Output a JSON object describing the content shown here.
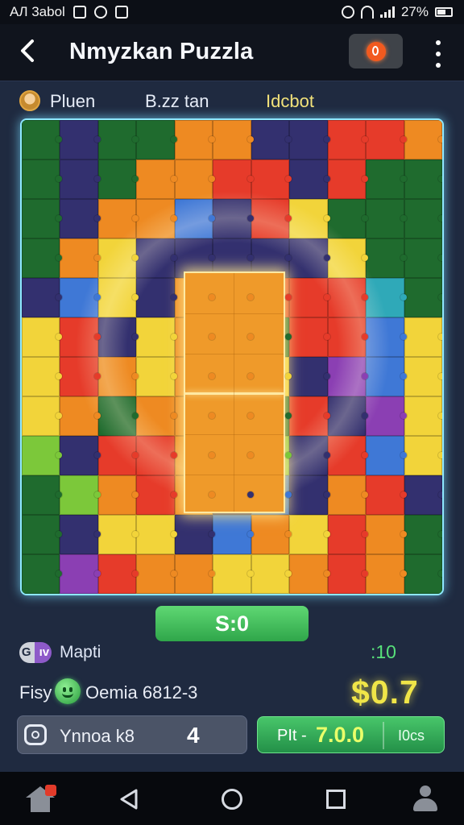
{
  "status_bar": {
    "left_text": "AЛ 3abol",
    "battery": "27%"
  },
  "header": {
    "title": "Nmyzkan Puzzla"
  },
  "info": {
    "player": "Pluen",
    "middle": "B.zz tan",
    "mode": "Idcbot"
  },
  "board": {
    "columns": 11,
    "rows": 12,
    "colors": {
      "green": "#1f6b2e",
      "navy": "#33306f",
      "orange": "#ee8a22",
      "red": "#e63b2a",
      "yellow": "#f2d43a",
      "blue": "#3f78d6",
      "purple": "#8b3fb3",
      "lime": "#7cc83a",
      "teal": "#2fa9b8"
    },
    "pattern": [
      [
        "green",
        "navy",
        "green",
        "green",
        "orange",
        "orange",
        "navy",
        "navy",
        "red",
        "red",
        "orange"
      ],
      [
        "green",
        "navy",
        "green",
        "orange",
        "orange",
        "red",
        "red",
        "navy",
        "red",
        "green",
        "green"
      ],
      [
        "green",
        "navy",
        "orange",
        "orange",
        "blue",
        "navy",
        "red",
        "yellow",
        "green",
        "green",
        "green"
      ],
      [
        "green",
        "orange",
        "yellow",
        "navy",
        "navy",
        "navy",
        "navy",
        "navy",
        "yellow",
        "green",
        "green"
      ],
      [
        "navy",
        "blue",
        "yellow",
        "navy",
        "orange",
        "orange",
        "red",
        "red",
        "red",
        "teal",
        "green"
      ],
      [
        "yellow",
        "red",
        "navy",
        "yellow",
        "orange",
        "orange",
        "green",
        "red",
        "red",
        "blue",
        "yellow"
      ],
      [
        "yellow",
        "red",
        "orange",
        "yellow",
        "orange",
        "orange",
        "yellow",
        "navy",
        "purple",
        "blue",
        "yellow"
      ],
      [
        "yellow",
        "orange",
        "green",
        "orange",
        "orange",
        "orange",
        "green",
        "red",
        "navy",
        "purple",
        "yellow"
      ],
      [
        "lime",
        "navy",
        "red",
        "red",
        "orange",
        "orange",
        "lime",
        "navy",
        "red",
        "blue",
        "yellow"
      ],
      [
        "green",
        "lime",
        "orange",
        "red",
        "orange",
        "navy",
        "blue",
        "navy",
        "orange",
        "red",
        "navy"
      ],
      [
        "green",
        "navy",
        "yellow",
        "yellow",
        "navy",
        "blue",
        "orange",
        "yellow",
        "red",
        "orange",
        "green"
      ],
      [
        "green",
        "purple",
        "red",
        "orange",
        "orange",
        "yellow",
        "yellow",
        "orange",
        "red",
        "orange",
        "green"
      ]
    ]
  },
  "score_button": "S:0",
  "stats": {
    "map_badge": "G",
    "map_badge_sub": "ıv",
    "map_label": "Mapti",
    "time": ":10",
    "fisy_label": "Fisy",
    "detail": "Oemia 6812-3",
    "money": "$0.7"
  },
  "input_bar": {
    "text": "Ynnoa k8",
    "count": "4"
  },
  "action_button": {
    "left": "PIt -",
    "value": "7.0.0",
    "right": "I0cs"
  }
}
